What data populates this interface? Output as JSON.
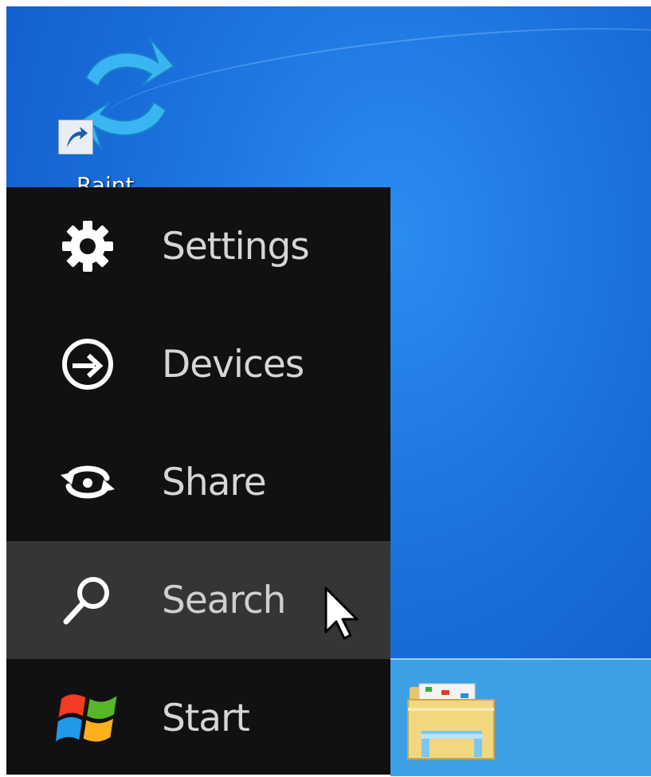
{
  "desktop": {
    "shortcut_label": "Raint"
  },
  "charms": [
    {
      "label": "Settings",
      "icon": "gear-icon",
      "hovered": false
    },
    {
      "label": "Devices",
      "icon": "devices-icon",
      "hovered": false
    },
    {
      "label": "Share",
      "icon": "share-icon",
      "hovered": false
    },
    {
      "label": "Search",
      "icon": "search-icon",
      "hovered": true
    },
    {
      "label": "Start",
      "icon": "windows-logo-icon",
      "hovered": false
    }
  ],
  "taskbar": {
    "pinned": [
      "file-explorer-icon"
    ]
  },
  "colors": {
    "charm_bar": "#111111",
    "charm_hover": "#353535",
    "desktop": "#1a70dc",
    "taskbar": "#3ea0e4"
  }
}
